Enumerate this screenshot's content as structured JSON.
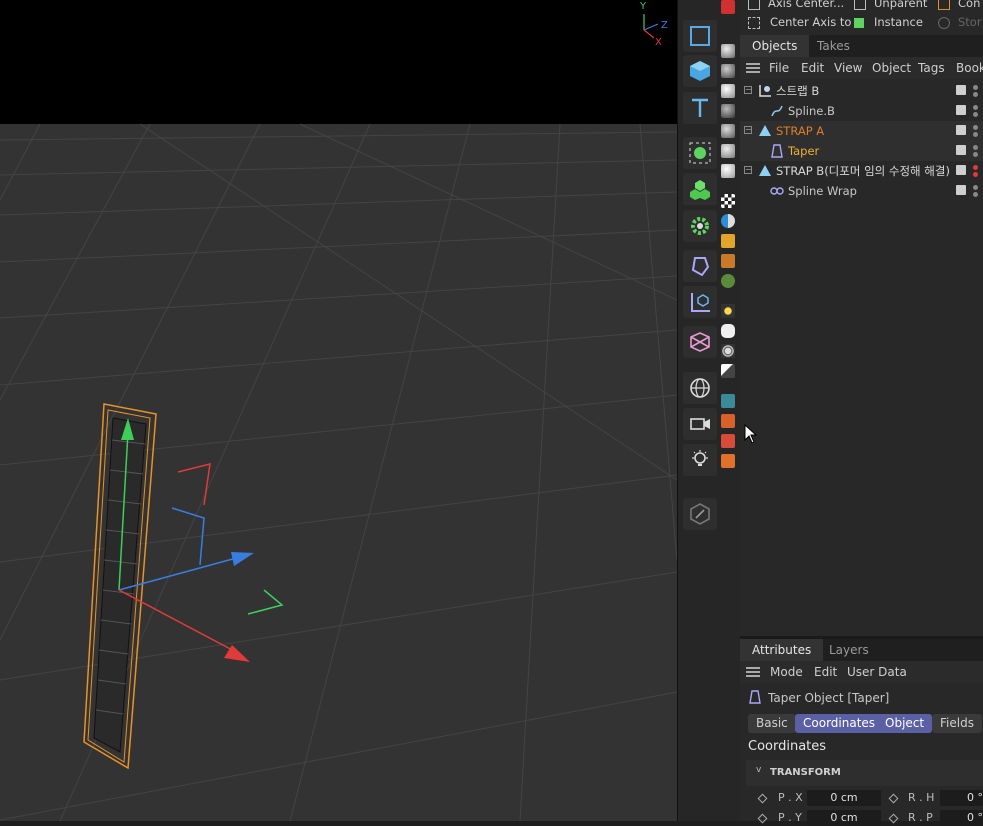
{
  "viewport": {
    "axis_labels": {
      "y": "Y",
      "z": "Z",
      "x": "X"
    }
  },
  "top_buttons": {
    "axis_center": "Axis Center...",
    "unparent": "Unparent",
    "connect": "Con",
    "center_axis_to": "Center Axis to",
    "instance": "Instance",
    "store": "Stor"
  },
  "objects_panel": {
    "tabs": [
      {
        "label": "Objects"
      },
      {
        "label": "Takes"
      }
    ],
    "menu": [
      "File",
      "Edit",
      "View",
      "Object",
      "Tags",
      "Bookm"
    ],
    "rows": [
      {
        "label": "스트랩 B",
        "color": "#d8d8d8"
      },
      {
        "label": "Spline.B",
        "color": "#c8c8c8"
      },
      {
        "label": "STRAP A",
        "color": "#e07c2a"
      },
      {
        "label": "Taper",
        "color": "#f0b030"
      },
      {
        "label": "STRAP B(디포머 임의 수정해 해결)",
        "color": "#d8d8d8"
      },
      {
        "label": "Spline Wrap",
        "color": "#c8c8c8"
      }
    ]
  },
  "attributes_panel": {
    "tabs": [
      {
        "label": "Attributes"
      },
      {
        "label": "Layers"
      }
    ],
    "menu": [
      "Mode",
      "Edit",
      "User Data"
    ],
    "object_title": "Taper Object [Taper]",
    "buttons": [
      "Basic",
      "Coordinates",
      "Object",
      "Fields"
    ],
    "section_title": "Coordinates",
    "group_title": "TRANSFORM",
    "fields": [
      {
        "label": "P . X",
        "value": "0 cm"
      },
      {
        "label": "R . H",
        "value": "0 °"
      },
      {
        "label": "P . Y",
        "value": "0 cm"
      },
      {
        "label": "R . P",
        "value": "0 °"
      }
    ]
  },
  "colors": {
    "accent": "#5b5fa4",
    "orange": "#e07c2a",
    "viewport_bg": "#333333"
  }
}
